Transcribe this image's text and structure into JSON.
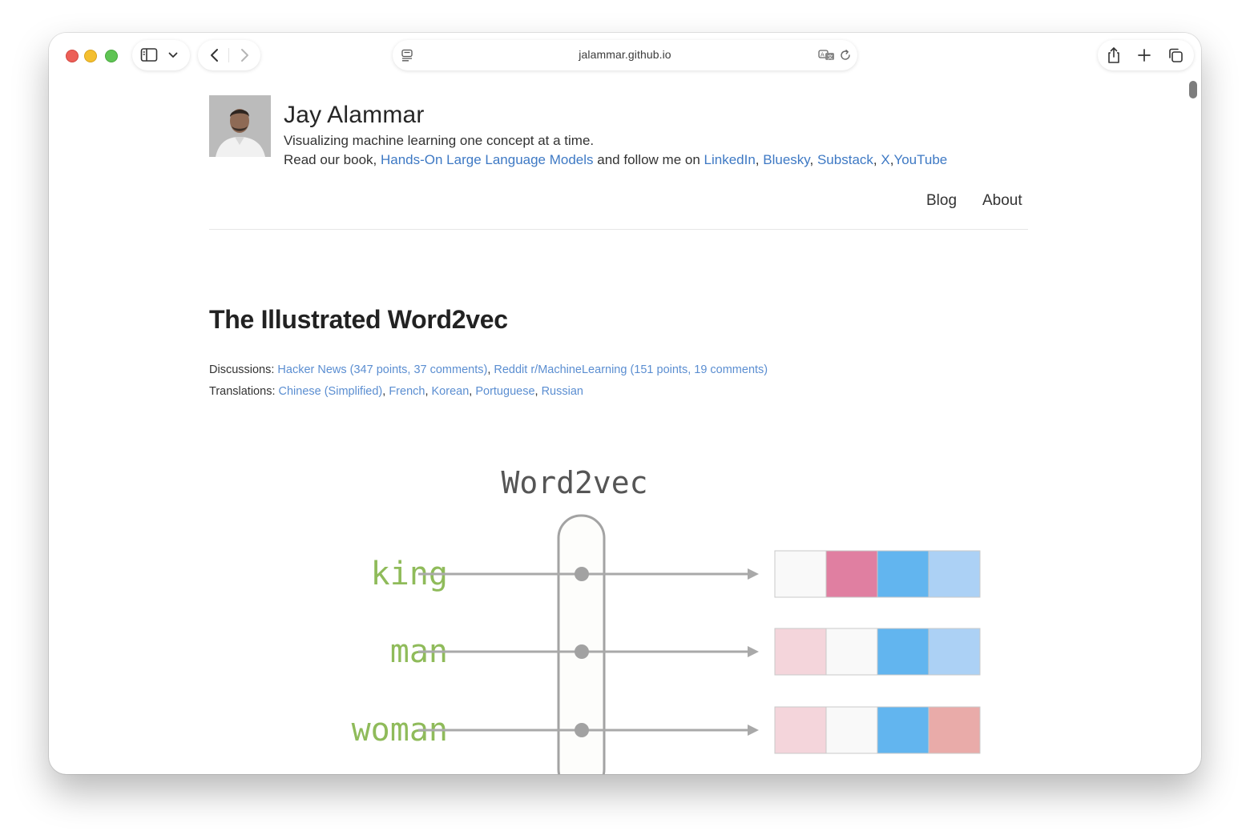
{
  "browser": {
    "url": "jalammar.github.io"
  },
  "header": {
    "site_title": "Jay Alammar",
    "tagline": "Visualizing machine learning one concept at a time.",
    "read_prefix": "Read our book, ",
    "book_link": "Hands-On Large Language Models",
    "follow_text": " and follow me on ",
    "social_links": [
      "LinkedIn",
      "Bluesky",
      "Substack",
      "X",
      "YouTube"
    ],
    "sep_comma": ", ",
    "sep_comma_tight": ","
  },
  "nav": {
    "blog": "Blog",
    "about": "About"
  },
  "post": {
    "title": "The Illustrated Word2vec",
    "discussions_label": "Discussions: ",
    "discussions": [
      "Hacker News (347 points, 37 comments)",
      "Reddit r/MachineLearning (151 points, 19 comments)"
    ],
    "translations_label": "Translations: ",
    "translations": [
      "Chinese (Simplified)",
      "French",
      "Korean",
      "Portuguese",
      "Russian"
    ]
  },
  "figure": {
    "title": "Word2vec",
    "words": [
      "king",
      "man",
      "woman"
    ],
    "vectors": [
      [
        "#f9f9f9",
        "#e07fa1",
        "#62b5ef",
        "#acd1f5"
      ],
      [
        "#f4d5db",
        "#f9f9f9",
        "#62b5ef",
        "#acd1f5"
      ],
      [
        "#f4d5db",
        "#f9f9f9",
        "#62b5ef",
        "#e9aba9"
      ]
    ],
    "word_color": "#8fbb5a",
    "title_color": "#555555"
  }
}
